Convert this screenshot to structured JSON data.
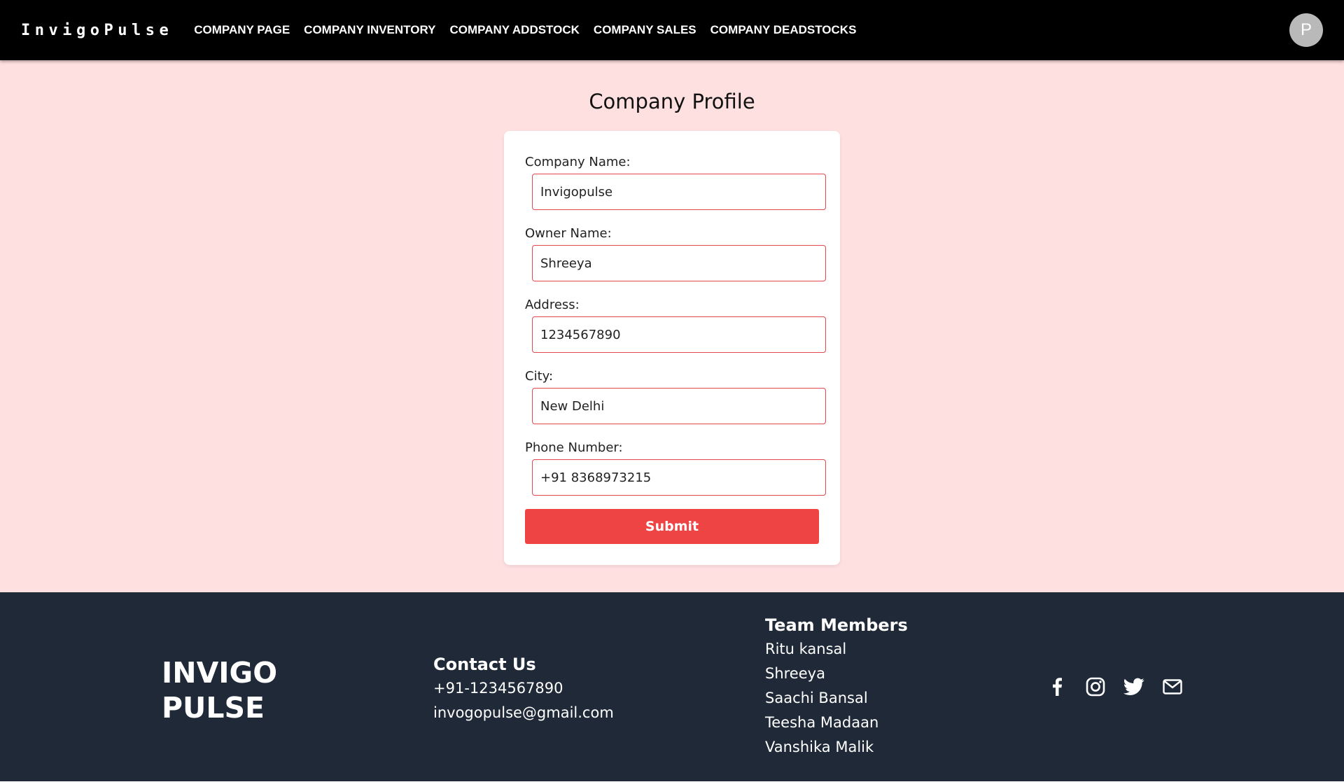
{
  "navbar": {
    "brand": "InvigoPulse",
    "links": [
      "COMPANY PAGE",
      "COMPANY INVENTORY",
      "COMPANY ADDSTOCK",
      "COMPANY SALES",
      "COMPANY DEADSTOCKS"
    ],
    "avatar_initial": "P"
  },
  "main": {
    "title": "Company Profile",
    "fields": [
      {
        "label": "Company Name:",
        "value": "Invigopulse"
      },
      {
        "label": "Owner Name:",
        "value": "Shreeya"
      },
      {
        "label": "Address:",
        "value": "1234567890"
      },
      {
        "label": "City:",
        "value": "New Delhi"
      },
      {
        "label": "Phone Number:",
        "value": "+91 8368973215"
      }
    ],
    "submit_label": "Submit"
  },
  "footer": {
    "logo_line1": "INVIGO",
    "logo_line2": "PULSE",
    "contact": {
      "heading": "Contact Us",
      "phone": "+91-1234567890",
      "email": "invogopulse@gmail.com"
    },
    "team": {
      "heading": "Team Members",
      "members": [
        "Ritu kansal",
        "Shreeya",
        "Saachi Bansal",
        "Teesha Madaan",
        "Vanshika Malik"
      ]
    },
    "social_icons": [
      "facebook-icon",
      "instagram-icon",
      "twitter-icon",
      "mail-icon"
    ]
  },
  "colors": {
    "navbar_bg": "#000000",
    "main_bg": "#ffe0e1",
    "input_border": "#e6474d",
    "submit_bg": "#ef4444",
    "footer_bg": "#1f2937"
  }
}
